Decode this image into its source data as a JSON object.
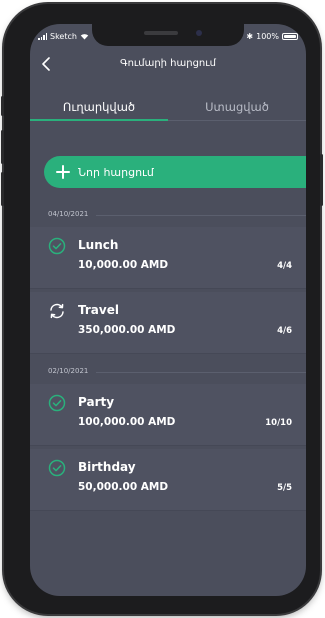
{
  "status_bar": {
    "carrier": "Sketch",
    "bluetooth": "✱",
    "battery": "100%"
  },
  "nav": {
    "title": "Գումարի հարցում"
  },
  "tabs": [
    {
      "label": "Ուղարկված",
      "active": true
    },
    {
      "label": "Ստացված",
      "active": false
    }
  ],
  "new_request": {
    "label": "Նոր հարցում"
  },
  "groups": [
    {
      "date": "04/10/2021",
      "items": [
        {
          "name": "Lunch",
          "amount": "10,000.00 AMD",
          "count": "4/4",
          "status": "completed"
        },
        {
          "name": "Travel",
          "amount": "350,000.00 AMD",
          "count": "4/6",
          "status": "in-progress"
        }
      ]
    },
    {
      "date": "02/10/2021",
      "items": [
        {
          "name": "Party",
          "amount": "100,000.00 AMD",
          "count": "10/10",
          "status": "completed"
        },
        {
          "name": "Birthday",
          "amount": "50,000.00 AMD",
          "count": "5/5",
          "status": "completed"
        }
      ]
    }
  ],
  "colors": {
    "accent": "#2ab07c",
    "background": "#4b4e5c",
    "row": "#4f5261"
  }
}
